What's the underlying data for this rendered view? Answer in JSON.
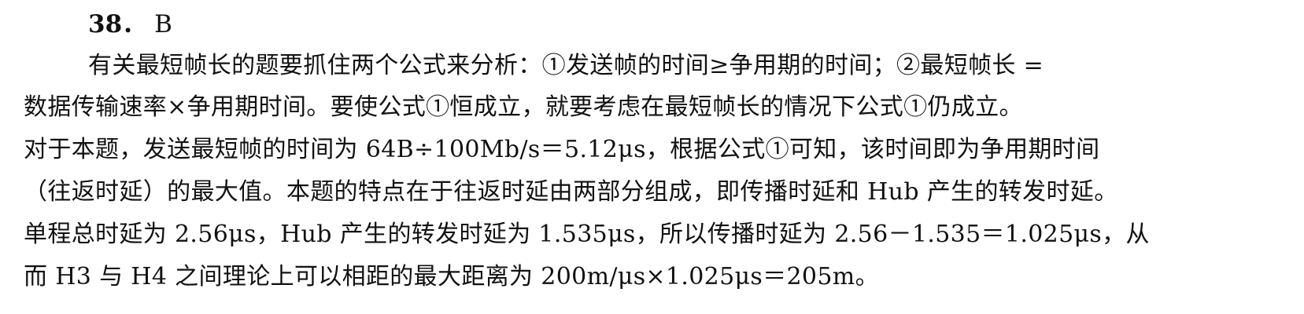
{
  "question": {
    "number": "38．",
    "answer": "B"
  },
  "explanation": {
    "lines": [
      "有关最短帧长的题要抓住两个公式来分析：①发送帧的时间≥争用期的时间；②最短帧长 =",
      "数据传输速率×争用期时间。要使公式①恒成立，就要考虑在最短帧长的情况下公式①仍成立。",
      "对于本题，发送最短帧的时间为 64B÷100Mb/s＝5.12μs，根据公式①可知，该时间即为争用期时间",
      "（往返时延）的最大值。本题的特点在于往返时延由两部分组成，即传播时延和 Hub 产生的转发时延。",
      "单程总时延为 2.56μs，Hub 产生的转发时延为 1.535μs，所以传播时延为 2.56－1.535＝1.025μs，从",
      "而 H3 与 H4 之间理论上可以相距的最大距离为 200m/μs×1.025μs＝205m。"
    ]
  }
}
